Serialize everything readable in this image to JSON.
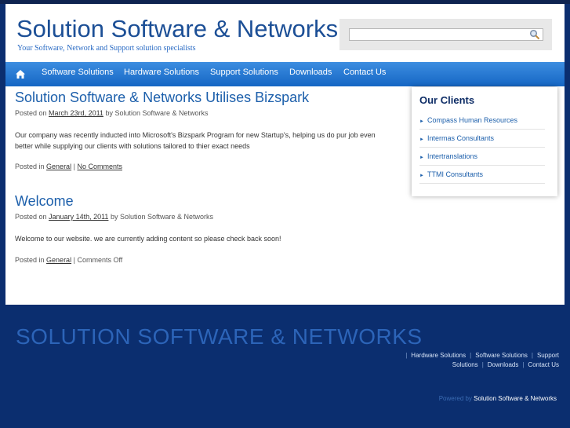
{
  "site": {
    "title": "Solution Software & Networks",
    "tagline": "Your Software, Network and Support solution specialists"
  },
  "search": {
    "value": "",
    "placeholder": ""
  },
  "nav": {
    "items": [
      {
        "label": "Software Solutions"
      },
      {
        "label": "Hardware Solutions"
      },
      {
        "label": "Support Solutions"
      },
      {
        "label": "Downloads"
      },
      {
        "label": "Contact Us"
      }
    ]
  },
  "posts": [
    {
      "title": "Solution Software & Networks Utilises Bizspark",
      "posted_on": "Posted on",
      "date": "March 23rd, 2011",
      "by": "by Solution Software & Networks",
      "body": "Our company was recently inducted into Microsoft's Bizspark Program for new Startup's, helping us do pur job even better while supplying our clients with solutions tailored to thier exact needs",
      "posted_in": "Posted in",
      "category": "General",
      "sep": "|",
      "comments": "No Comments"
    },
    {
      "title": "Welcome",
      "posted_on": "Posted on",
      "date": "January 14th, 2011",
      "by": "by Solution Software & Networks",
      "body": "Welcome to our website. we are currently adding content so please check back soon!",
      "posted_in": "Posted in",
      "category": "General",
      "sep": "|",
      "comments": "Comments Off"
    }
  ],
  "sidebar": {
    "title": "Our Clients",
    "clients": [
      {
        "label": "Compass Human Resources"
      },
      {
        "label": "Intermas Consultants"
      },
      {
        "label": "Intertranslations"
      },
      {
        "label": "TTMI Consultants"
      }
    ]
  },
  "footer": {
    "title": "SOLUTION SOFTWARE & NETWORKS",
    "links": [
      {
        "label": "Hardware Solutions"
      },
      {
        "label": "Software Solutions"
      },
      {
        "label": "Support Solutions"
      },
      {
        "label": "Downloads"
      },
      {
        "label": "Contact Us"
      }
    ],
    "separator": "|",
    "powered_label": "Powered by",
    "powered_name": "Solution Software & Networks"
  },
  "colors": {
    "accent": "#1c5fab",
    "nav": "#2a7ad6",
    "footer_bg": "#0b2e6f"
  },
  "icons": {
    "home": "home-icon",
    "search": "search-icon",
    "bullet": "triangle-right-icon"
  }
}
